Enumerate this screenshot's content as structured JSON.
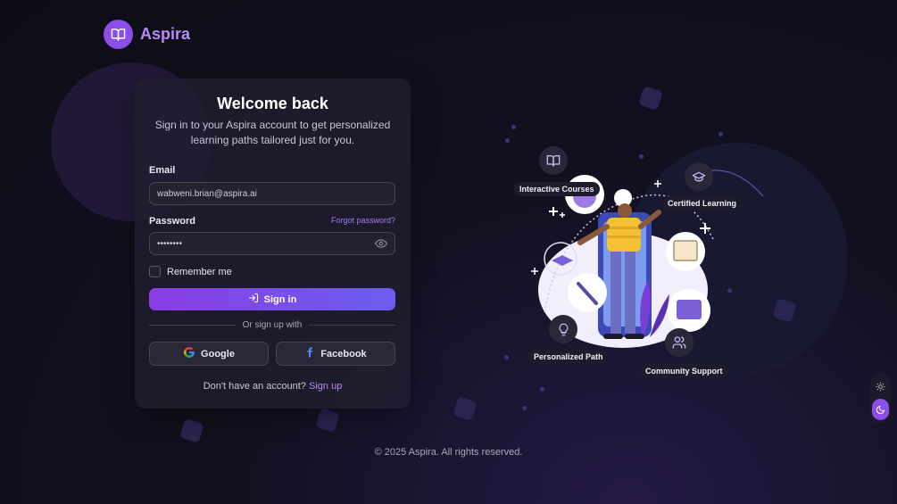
{
  "brand": {
    "name": "Aspira",
    "icon": "book-open-icon"
  },
  "login": {
    "title": "Welcome back",
    "subtitle": "Sign in to your Aspira account to get personalized learning paths tailored just for you.",
    "email_label": "Email",
    "email_value": "wabweni.brian@aspira.ai",
    "password_label": "Password",
    "password_value": "••••••••",
    "forgot_password": "Forgot password?",
    "remember_me": "Remember me",
    "sign_in": "Sign in",
    "divider": "Or sign up with",
    "google": "Google",
    "facebook": "Facebook",
    "no_account": "Don't have an account?",
    "sign_up": "Sign up"
  },
  "illustration": {
    "features": [
      {
        "label": "Interactive Courses",
        "icon": "book-open-icon"
      },
      {
        "label": "Certified Learning",
        "icon": "graduation-cap-icon"
      },
      {
        "label": "Personalized Path",
        "icon": "lightbulb-icon"
      },
      {
        "label": "Community Support",
        "icon": "users-icon"
      }
    ]
  },
  "footer": {
    "copyright": "© 2025 Aspira. All rights reserved."
  },
  "theme": {
    "options": [
      "sun-icon",
      "moon-icon"
    ],
    "active": "moon-icon",
    "accent": "#8b4fe6"
  }
}
